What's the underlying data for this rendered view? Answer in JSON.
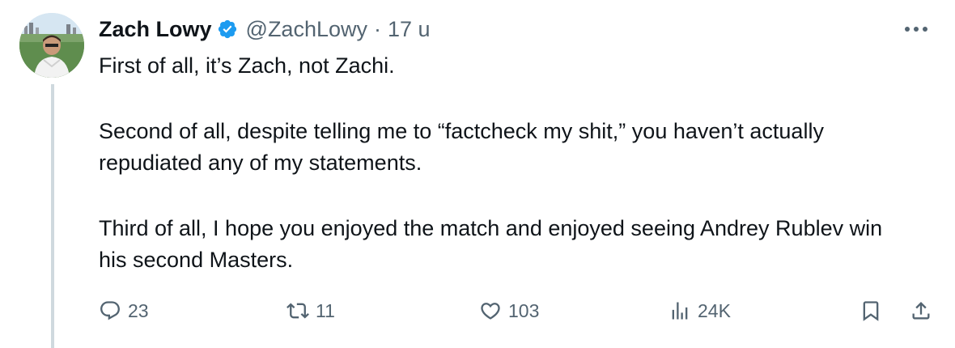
{
  "tweet": {
    "author": {
      "display_name": "Zach Lowy",
      "handle": "@ZachLowy",
      "verified": true,
      "avatar_icon": "profile-photo"
    },
    "separator": "·",
    "time": "17 u",
    "more_icon": "more-horizontal-icon",
    "paragraphs": [
      "First of all, it’s Zach, not Zachi.",
      "Second of all, despite telling me to “factcheck my shit,” you haven’t actually repudiated any of my statements.",
      "Third of all, I hope you enjoyed the match and enjoyed seeing Andrey Rublev win his second Masters."
    ],
    "stats": {
      "replies": "23",
      "retweets": "11",
      "likes": "103",
      "views": "24K"
    }
  },
  "colors": {
    "text_primary": "#0f1419",
    "text_secondary": "#536471",
    "verified_blue": "#1d9bf0",
    "thread_line": "#cfd9de"
  }
}
